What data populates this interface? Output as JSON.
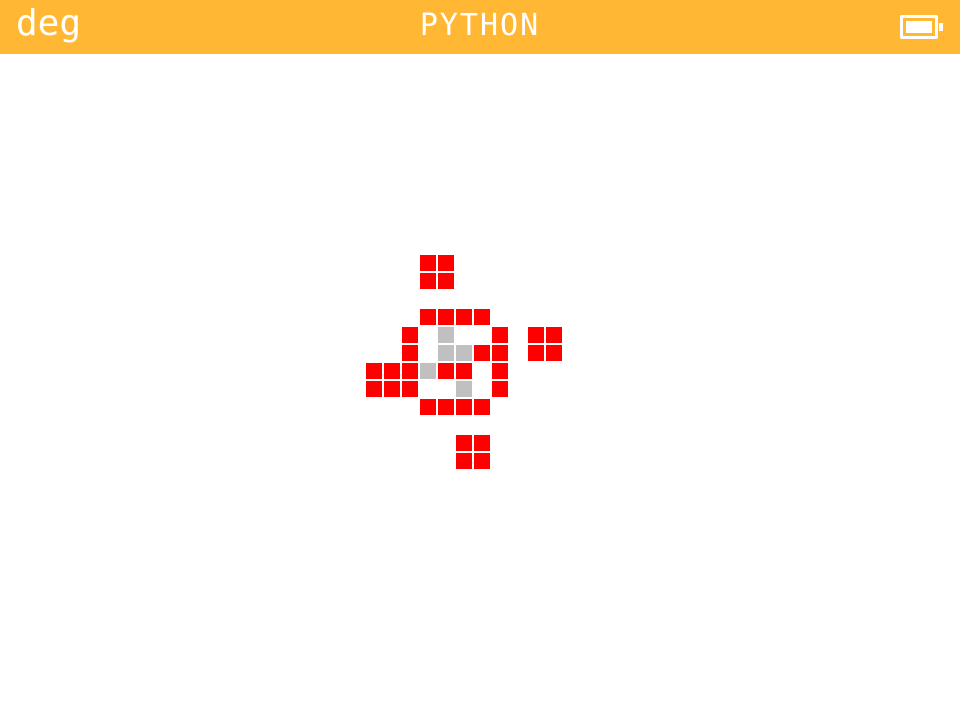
{
  "status_bar": {
    "angle_mode": "deg",
    "app_title": "PYTHON",
    "battery_icon": "battery-full-icon",
    "background_color": "#ffb734",
    "text_color": "#ffffff"
  },
  "canvas": {
    "background_color": "#ffffff",
    "grid_cells": {
      "red": [
        [
          3,
          0
        ],
        [
          4,
          0
        ],
        [
          3,
          1
        ],
        [
          4,
          1
        ],
        [
          3,
          3
        ],
        [
          4,
          3
        ],
        [
          5,
          3
        ],
        [
          6,
          3
        ],
        [
          2,
          4
        ],
        [
          7,
          4
        ],
        [
          9,
          4
        ],
        [
          10,
          4
        ],
        [
          2,
          5
        ],
        [
          6,
          5
        ],
        [
          7,
          5
        ],
        [
          9,
          5
        ],
        [
          10,
          5
        ],
        [
          0,
          6
        ],
        [
          1,
          6
        ],
        [
          2,
          6
        ],
        [
          4,
          6
        ],
        [
          5,
          6
        ],
        [
          7,
          6
        ],
        [
          0,
          7
        ],
        [
          1,
          7
        ],
        [
          2,
          7
        ],
        [
          7,
          7
        ],
        [
          3,
          8
        ],
        [
          4,
          8
        ],
        [
          5,
          8
        ],
        [
          6,
          8
        ],
        [
          5,
          10
        ],
        [
          6,
          10
        ],
        [
          5,
          11
        ],
        [
          6,
          11
        ]
      ],
      "gray": [
        [
          4,
          4
        ],
        [
          4,
          5
        ],
        [
          5,
          5
        ],
        [
          3,
          6
        ],
        [
          5,
          7
        ]
      ]
    },
    "colors": {
      "red": "#ff0000",
      "gray": "#c0c0c0"
    }
  }
}
